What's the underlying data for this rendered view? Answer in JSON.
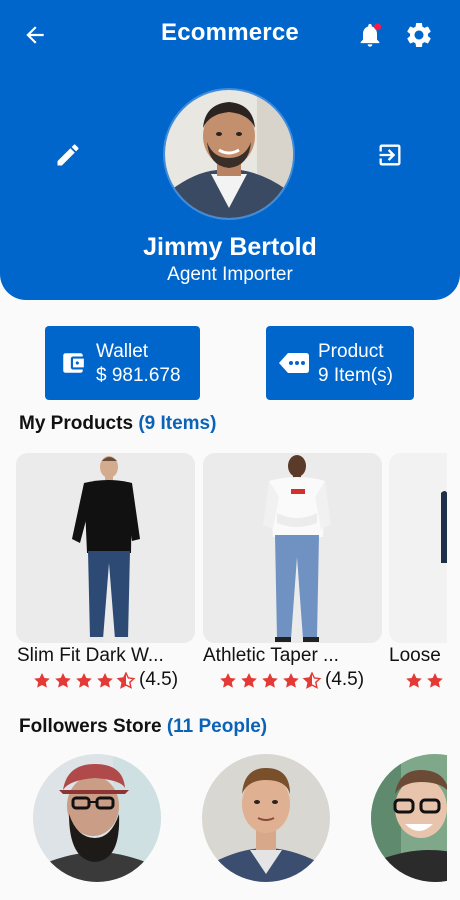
{
  "app_bar": {
    "title": "Ecommerce",
    "back_icon": "arrow-back-icon",
    "notification_icon": "bell-icon",
    "settings_icon": "gear-icon"
  },
  "profile": {
    "name": "Jimmy Bertold",
    "role": "Agent Importer",
    "edit_icon": "pencil-icon",
    "logout_icon": "exit-icon"
  },
  "stats": {
    "wallet": {
      "title": "Wallet",
      "value": "$ 981.678",
      "icon": "wallet-icon"
    },
    "product": {
      "title": "Product",
      "value": "9 Item(s)",
      "icon": "tag-icon"
    }
  },
  "products_section": {
    "title": "My Products",
    "count": "(9 Items)",
    "items": [
      {
        "name": "Slim Fit Dark W...",
        "rating": "(4.5)"
      },
      {
        "name": "Athletic Taper ...",
        "rating": "(4.5)"
      },
      {
        "name": "Loose"
      }
    ]
  },
  "followers_section": {
    "title": "Followers Store",
    "count": "(11 People)"
  },
  "colors": {
    "primary": "#0066cc",
    "star": "#e53935",
    "count_text": "#0b63b8",
    "badge": "#ff1744"
  }
}
